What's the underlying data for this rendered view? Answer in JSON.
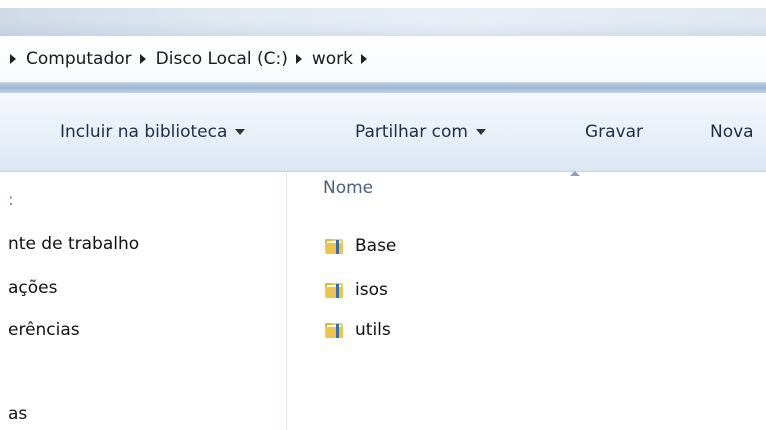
{
  "address_bar": {
    "crumbs": [
      "Computador",
      "Disco Local (C:)",
      "work"
    ]
  },
  "toolbar": {
    "include_in_library": "Incluir na biblioteca",
    "share_with": "Partilhar com",
    "burn": "Gravar",
    "new_folder_partial": "Nova"
  },
  "nav_pane": {
    "items": [
      ":",
      "nte de trabalho",
      "ações",
      "erências",
      "as"
    ]
  },
  "content": {
    "column_name": "Nome",
    "files": [
      "Base",
      "isos",
      "utils"
    ]
  },
  "icons": {
    "folder": "folder-icon"
  },
  "colors": {
    "toolbar_text": "#1f2e45",
    "column_header_text": "#4b5e78",
    "folder_yellow": "#f3cd58"
  }
}
